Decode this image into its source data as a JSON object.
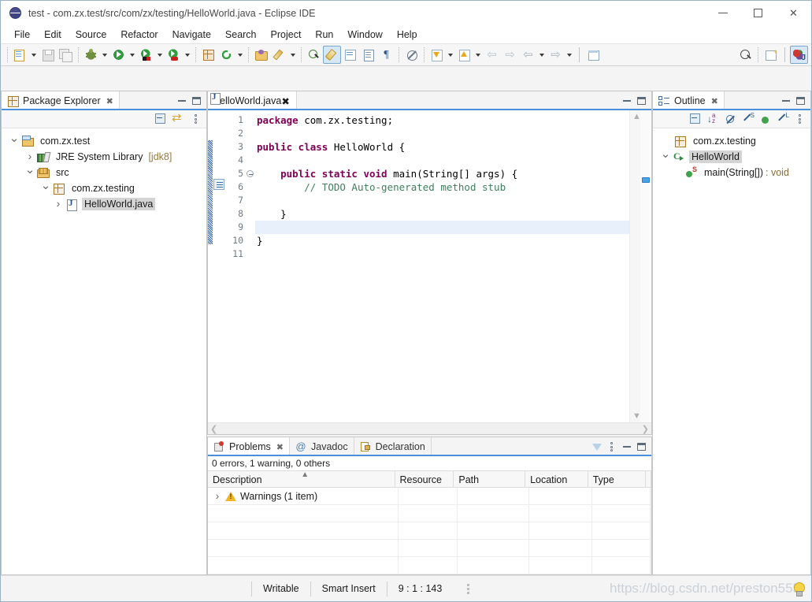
{
  "window": {
    "title": "test - com.zx.test/src/com/zx/testing/HelloWorld.java - Eclipse IDE",
    "app_icon": "eclipse-icon",
    "controls": {
      "minimize": "–",
      "maximize": "□",
      "close": "✕"
    }
  },
  "menubar": {
    "items": [
      "File",
      "Edit",
      "Source",
      "Refactor",
      "Navigate",
      "Search",
      "Project",
      "Run",
      "Window",
      "Help"
    ]
  },
  "toolbar": {
    "groups": [
      {
        "items": [
          {
            "name": "new-wizard-button",
            "icon": "new-document-icon",
            "dropdown": true
          },
          {
            "name": "save-button",
            "icon": "save-icon",
            "dropdown": false
          },
          {
            "name": "save-all-button",
            "icon": "save-all-icon",
            "dropdown": false
          }
        ]
      },
      {
        "items": [
          {
            "name": "debug-button",
            "icon": "debug-bug-icon",
            "dropdown": true
          },
          {
            "name": "run-button",
            "icon": "run-green-play-icon",
            "dropdown": true
          },
          {
            "name": "coverage-button",
            "icon": "run-coverage-icon",
            "dropdown": true
          },
          {
            "name": "run-external-tools-button",
            "icon": "external-tools-icon",
            "dropdown": true
          }
        ]
      },
      {
        "items": [
          {
            "name": "new-java-package-button",
            "icon": "package-grid-icon",
            "dropdown": false
          },
          {
            "name": "new-java-class-button",
            "icon": "refresh-circle-icon",
            "dropdown": true
          }
        ]
      },
      {
        "items": [
          {
            "name": "open-type-button",
            "icon": "open-folder-icon",
            "dropdown": false
          },
          {
            "name": "open-task-button",
            "icon": "pencil-icon",
            "dropdown": true
          }
        ]
      },
      {
        "items": [
          {
            "name": "search-button",
            "icon": "search-green-icon",
            "dropdown": false
          },
          {
            "name": "toggle-mark-occurrences-button",
            "icon": "marker-pen-icon",
            "selected": true
          },
          {
            "name": "open-editor-button",
            "icon": "editor-window-icon",
            "dropdown": false
          },
          {
            "name": "toggle-block-selection-button",
            "icon": "block-lines-icon",
            "dropdown": false
          },
          {
            "name": "show-whitespace-button",
            "icon": "pilcrow-icon",
            "dropdown": false
          }
        ]
      },
      {
        "items": [
          {
            "name": "skip-all-breakpoints-button",
            "icon": "no-breakpoint-icon",
            "dropdown": false
          }
        ]
      },
      {
        "items": [
          {
            "name": "next-annotation-button",
            "icon": "next-annotation-icon",
            "dropdown": true
          },
          {
            "name": "previous-annotation-button",
            "icon": "previous-annotation-icon",
            "dropdown": true
          },
          {
            "name": "last-edit-location-button",
            "icon": "last-edit-location-icon",
            "dropdown": false
          },
          {
            "name": "forward-edit-button",
            "icon": "forward-edit-icon",
            "dropdown": false
          },
          {
            "name": "back-button",
            "icon": "back-arrow-icon",
            "dropdown": true
          },
          {
            "name": "forward-button",
            "icon": "forward-arrow-icon",
            "dropdown": true
          }
        ]
      },
      {
        "items": [
          {
            "name": "new-window-button",
            "icon": "new-window-icon",
            "dropdown": false
          }
        ]
      }
    ],
    "right": [
      {
        "name": "quick-access-button",
        "icon": "magnifier-icon"
      },
      {
        "name": "open-perspective-button",
        "icon": "open-perspective-icon"
      },
      {
        "name": "java-perspective-button",
        "icon": "java-perspective-icon",
        "selected": true
      }
    ]
  },
  "package_explorer": {
    "tab_label": "Package Explorer",
    "tab_icon": "package-explorer-icon",
    "close_glyph": "✖",
    "tools": [
      {
        "name": "collapse-all-button",
        "icon": "collapse-all-icon"
      },
      {
        "name": "link-with-editor-button",
        "icon": "link-with-editor-icon"
      },
      {
        "name": "view-menu-button",
        "icon": "view-menu-icon"
      }
    ],
    "minimize_label": "Minimize",
    "maximize_label": "Maximize",
    "tree": [
      {
        "label": "com.zx.test",
        "icon": "java-project-icon",
        "indent": 0,
        "twisty": "open",
        "selected": false
      },
      {
        "label": "JRE System Library",
        "suffix": "[jdk8]",
        "icon": "jre-library-icon",
        "indent": 1,
        "twisty": "closed",
        "selected": false
      },
      {
        "label": "src",
        "icon": "source-folder-icon",
        "indent": 1,
        "twisty": "open",
        "selected": false
      },
      {
        "label": "com.zx.testing",
        "icon": "package-icon",
        "indent": 2,
        "twisty": "open",
        "selected": false
      },
      {
        "label": "HelloWorld.java",
        "icon": "java-file-icon",
        "indent": 3,
        "twisty": "closed",
        "selected": true
      }
    ]
  },
  "editor": {
    "tab_label": "HelloWorld.java",
    "tab_icon": "java-file-icon",
    "close_glyph": "✖",
    "minimize_label": "Minimize",
    "maximize_label": "Maximize",
    "lines": [
      {
        "no": "1",
        "fold": false,
        "highlight": false,
        "tokens": [
          {
            "t": "package ",
            "c": "kw"
          },
          {
            "t": "com.zx.testing;",
            "c": "pl"
          }
        ]
      },
      {
        "no": "2",
        "fold": false,
        "highlight": false,
        "tokens": []
      },
      {
        "no": "3",
        "fold": false,
        "highlight": false,
        "tokens": [
          {
            "t": "public class ",
            "c": "kw"
          },
          {
            "t": "HelloWorld {",
            "c": "pl"
          }
        ]
      },
      {
        "no": "4",
        "fold": false,
        "highlight": false,
        "tokens": []
      },
      {
        "no": "5",
        "fold": true,
        "highlight": false,
        "tokens": [
          {
            "t": "    ",
            "c": "pl"
          },
          {
            "t": "public static void ",
            "c": "kw"
          },
          {
            "t": "main(String[] args) {",
            "c": "pl"
          }
        ]
      },
      {
        "no": "6",
        "fold": false,
        "highlight": false,
        "tokens": [
          {
            "t": "        ",
            "c": "pl"
          },
          {
            "t": "// ",
            "c": "cm"
          },
          {
            "t": "TODO",
            "c": "todo"
          },
          {
            "t": " Auto-generated method stub",
            "c": "cm"
          }
        ]
      },
      {
        "no": "7",
        "fold": false,
        "highlight": false,
        "tokens": []
      },
      {
        "no": "8",
        "fold": false,
        "highlight": false,
        "tokens": [
          {
            "t": "    }",
            "c": "pl"
          }
        ]
      },
      {
        "no": "9",
        "fold": false,
        "highlight": true,
        "tokens": []
      },
      {
        "no": "10",
        "fold": false,
        "highlight": false,
        "tokens": [
          {
            "t": "}",
            "c": "pl"
          }
        ]
      },
      {
        "no": "11",
        "fold": false,
        "highlight": false,
        "tokens": []
      }
    ]
  },
  "outline": {
    "tab_label": "Outline",
    "tab_icon": "outline-icon",
    "close_glyph": "✖",
    "tools": [
      {
        "name": "collapse-all-button",
        "icon": "collapse-all-icon"
      },
      {
        "name": "sort-button",
        "icon": "sort-az-icon"
      },
      {
        "name": "hide-fields-button",
        "icon": "hide-fields-icon"
      },
      {
        "name": "hide-static-button",
        "icon": "hide-static-icon"
      },
      {
        "name": "hide-nonpublic-button",
        "icon": "hide-nonpublic-icon"
      },
      {
        "name": "hide-local-types-button",
        "icon": "hide-local-types-icon"
      },
      {
        "name": "view-menu-button",
        "icon": "view-menu-icon"
      }
    ],
    "tree": [
      {
        "label": "com.zx.testing",
        "icon": "package-icon",
        "indent": 1,
        "twisty": "none",
        "selected": false
      },
      {
        "label": "HelloWorld",
        "icon": "class-icon",
        "indent": 0,
        "twisty": "open",
        "selected": true
      },
      {
        "label": "main(String[])",
        "return_type": " : void",
        "icon": "method-static-icon",
        "indent": 2,
        "twisty": "none",
        "selected": false
      }
    ]
  },
  "problems": {
    "tabs": [
      {
        "label": "Problems",
        "icon": "problems-icon",
        "active": true,
        "close_glyph": "✖"
      },
      {
        "label": "Javadoc",
        "icon": "javadoc-at-icon",
        "active": false
      },
      {
        "label": "Declaration",
        "icon": "declaration-icon",
        "active": false
      }
    ],
    "tools": [
      {
        "name": "filter-button",
        "icon": "filter-funnel-icon"
      },
      {
        "name": "view-menu-button",
        "icon": "view-menu-icon"
      }
    ],
    "summary": "0 errors, 1 warning, 0 others",
    "columns": [
      "Description",
      "Resource",
      "Path",
      "Location",
      "Type"
    ],
    "sorted_column": "Description",
    "sort_direction": "ascending",
    "rows": [
      {
        "description": "Warnings (1 item)",
        "icon": "warning-icon",
        "twisty": "closed",
        "resource": "",
        "path": "",
        "location": "",
        "type": ""
      }
    ],
    "empty_row_count": 4
  },
  "statusbar": {
    "writable": "Writable",
    "insert_mode": "Smart Insert",
    "position": "9 : 1 : 143",
    "watermark": "https://blog.csdn.net/preston555",
    "tip_icon": "lightbulb-icon"
  }
}
